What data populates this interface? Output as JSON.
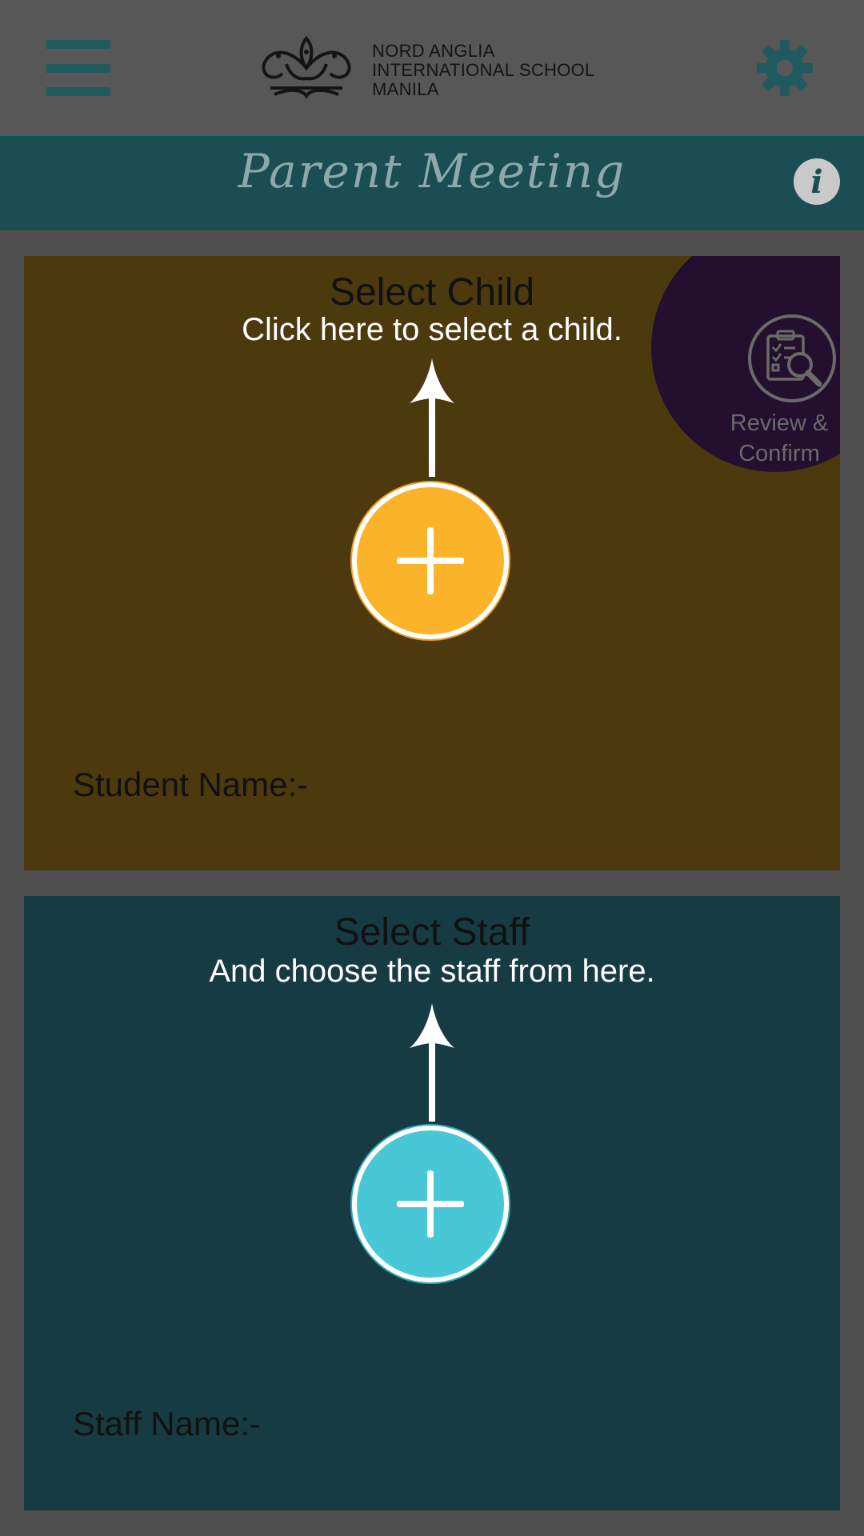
{
  "header": {
    "logo": {
      "lines": [
        "NORD ANGLIA",
        "INTERNATIONAL SCHOOL",
        "MANILA"
      ]
    },
    "menu_icon": "hamburger-icon",
    "settings_icon": "gear-icon"
  },
  "titlebar": {
    "title": "Parent Meeting",
    "info_label": "i"
  },
  "child_section": {
    "title": "Select Child",
    "hint": "Click here to select a child.",
    "field_label": "Student Name:-",
    "button_color": "#fbb42a",
    "background": "#4c390d"
  },
  "review": {
    "line1": "Review &",
    "line2": "Confirm"
  },
  "staff_section": {
    "title": "Select Staff",
    "hint": "And choose the staff from here.",
    "field_label": "Staff Name:-",
    "button_color": "#48c8d6",
    "background": "#163b42"
  },
  "colors": {
    "accent": "#1b4e53",
    "overlay": "#4f4f4f"
  }
}
